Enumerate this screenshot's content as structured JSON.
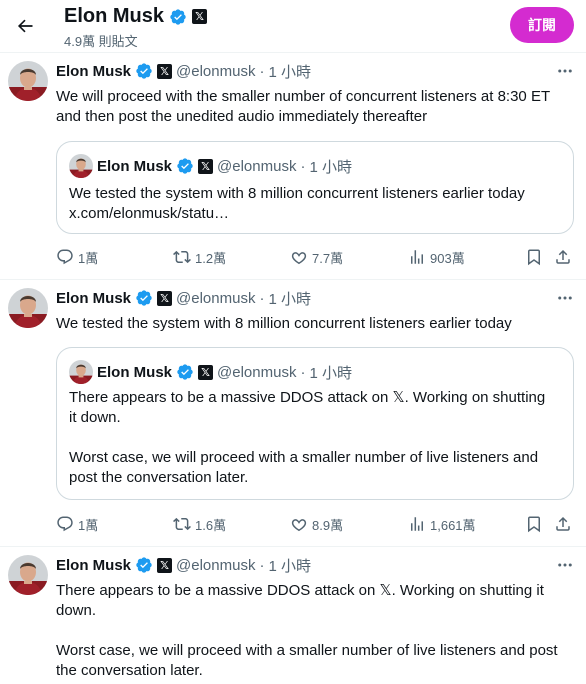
{
  "header": {
    "title": "Elon Musk",
    "x_badge": "𝕏",
    "post_count": "4.9萬 則貼文",
    "subscribe_label": "訂閱"
  },
  "colors": {
    "accent": "#d42bd0",
    "verified": "#1d9bf0",
    "text": "#0f1419",
    "muted": "#536471",
    "border": "#cfd9de"
  },
  "tweets": [
    {
      "name": "Elon Musk",
      "x_badge": "𝕏",
      "handle": "@elonmusk",
      "dot": "·",
      "time": "1 小時",
      "text": "We will proceed with the smaller number of concurrent listeners at 8:30 ET\nand then post the unedited audio immediately thereafter",
      "quote": {
        "name": "Elon Musk",
        "x_badge": "𝕏",
        "handle": "@elonmusk",
        "dot": "·",
        "time": "1 小時",
        "text": "We tested the system with 8 million concurrent listeners earlier today\nx.com/elonmusk/statu…"
      },
      "actions": {
        "replies": "1萬",
        "reposts": "1.2萬",
        "likes": "7.7萬",
        "views": "903萬"
      }
    },
    {
      "name": "Elon Musk",
      "x_badge": "𝕏",
      "handle": "@elonmusk",
      "dot": "·",
      "time": "1 小時",
      "text": "We tested the system with 8 million concurrent listeners earlier today",
      "quote": {
        "name": "Elon Musk",
        "x_badge": "𝕏",
        "handle": "@elonmusk",
        "dot": "·",
        "time": "1 小時",
        "text": "There appears to be a massive DDOS attack on 𝕏. Working on shutting\nit down.\n\nWorst case, we will proceed with a smaller number of live listeners and\npost the conversation later."
      },
      "actions": {
        "replies": "1萬",
        "reposts": "1.6萬",
        "likes": "8.9萬",
        "views": "1,661萬"
      }
    },
    {
      "name": "Elon Musk",
      "x_badge": "𝕏",
      "handle": "@elonmusk",
      "dot": "·",
      "time": "1 小時",
      "text": "There appears to be a massive DDOS attack on 𝕏. Working on shutting it\ndown.\n\nWorst case, we will proceed with a smaller number of live listeners and post\nthe conversation later."
    }
  ]
}
